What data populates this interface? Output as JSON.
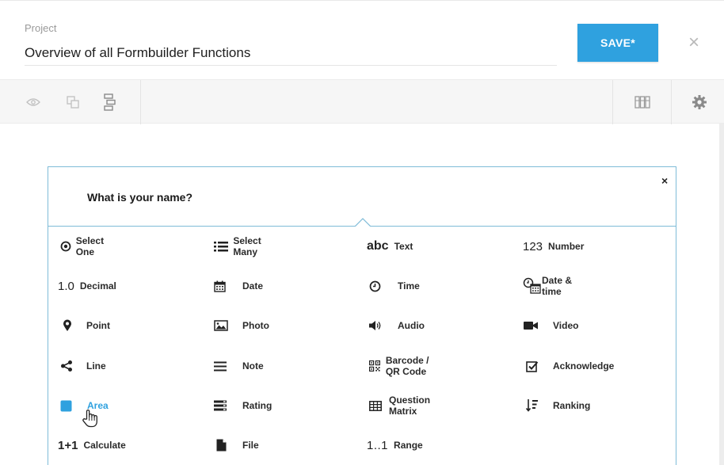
{
  "header": {
    "project_label": "Project",
    "project_name": "Overview of all Formbuilder Functions",
    "save_label": "SAVE*",
    "close_glyph": "×"
  },
  "toolbar": {
    "left_icons": [
      "eye-icon",
      "copy-icon",
      "tree-icon"
    ],
    "right_icons": [
      "library-icon",
      "settings-gear-icon"
    ]
  },
  "question": {
    "title": "What is your name?",
    "close_glyph": "×"
  },
  "types": [
    {
      "label": "Select One",
      "icon": "radio-icon"
    },
    {
      "label": "Select Many",
      "icon": "list-icon"
    },
    {
      "label": "Text",
      "icon": "text-icon",
      "icon_text": "abc"
    },
    {
      "label": "Number",
      "icon": "number-icon",
      "icon_text": "123"
    },
    {
      "label": "Decimal",
      "icon": "decimal-icon",
      "icon_text": "1.0"
    },
    {
      "label": "Date",
      "icon": "calendar-icon"
    },
    {
      "label": "Time",
      "icon": "clock-icon"
    },
    {
      "label": "Date & time",
      "icon": "clock-calendar-icon"
    },
    {
      "label": "Point",
      "icon": "pin-icon"
    },
    {
      "label": "Photo",
      "icon": "image-icon"
    },
    {
      "label": "Audio",
      "icon": "speaker-icon"
    },
    {
      "label": "Video",
      "icon": "camera-icon"
    },
    {
      "label": "Line",
      "icon": "share-icon"
    },
    {
      "label": "Note",
      "icon": "lines-icon"
    },
    {
      "label": "Barcode / QR Code",
      "icon": "qr-icon"
    },
    {
      "label": "Acknowledge",
      "icon": "checkbox-icon"
    },
    {
      "label": "Area",
      "icon": "square-icon"
    },
    {
      "label": "Rating",
      "icon": "rating-icon"
    },
    {
      "label": "Question Matrix",
      "icon": "table-icon"
    },
    {
      "label": "Ranking",
      "icon": "sort-icon"
    },
    {
      "label": "Calculate",
      "icon": "calculate-icon",
      "icon_text": "1+1"
    },
    {
      "label": "File",
      "icon": "file-icon"
    },
    {
      "label": "Range",
      "icon": "range-icon",
      "icon_text": "1..1"
    }
  ],
  "colors": {
    "accent": "#2fa1df",
    "card_border": "#7fbcd8"
  }
}
